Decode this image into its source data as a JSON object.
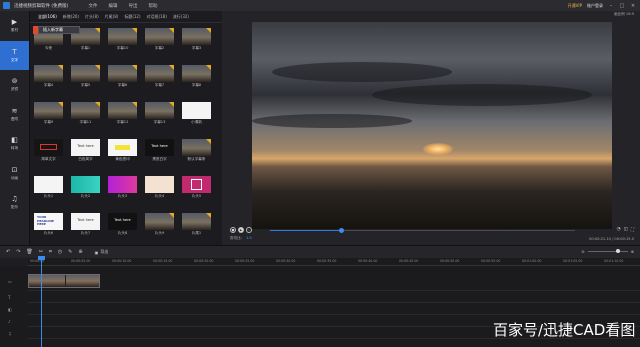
{
  "titlebar": {
    "app_title": "迅捷视频剪辑软件 (免费版)",
    "menu": [
      "文件",
      "编辑",
      "导出",
      "帮助"
    ],
    "vip": "开通VIP",
    "account": "账户登录"
  },
  "rail": [
    {
      "label": "素材",
      "icon": "▶"
    },
    {
      "label": "文字",
      "icon": "T"
    },
    {
      "label": "滤镜",
      "icon": "⊚"
    },
    {
      "label": "叠附",
      "icon": "≋"
    },
    {
      "label": "转场",
      "icon": "◧"
    },
    {
      "label": "动画",
      "icon": "⊡"
    },
    {
      "label": "配乐",
      "icon": "♫"
    }
  ],
  "library": {
    "tabs": [
      "全部(106)",
      "新增(20)",
      "片头(8)",
      "片尾(8)",
      "标题(12)",
      "对话框(18)",
      "流行(32)"
    ],
    "popup": "插入新字幕",
    "items": [
      {
        "label": "今夜",
        "style": "sky"
      },
      {
        "label": "字幕1",
        "style": "sky"
      },
      {
        "label": "字幕10",
        "style": "sky"
      },
      {
        "label": "字幕2",
        "style": "sky"
      },
      {
        "label": "字幕3",
        "style": "sky"
      },
      {
        "label": "字幕4",
        "style": "sky"
      },
      {
        "label": "字幕5",
        "style": "sky"
      },
      {
        "label": "字幕6",
        "style": "sky"
      },
      {
        "label": "字幕7",
        "style": "sky"
      },
      {
        "label": "字幕8",
        "style": "sky"
      },
      {
        "label": "字幕9",
        "style": "sky"
      },
      {
        "label": "字幕11",
        "style": "sky"
      },
      {
        "label": "字幕12",
        "style": "sky"
      },
      {
        "label": "字幕13",
        "style": "sky"
      },
      {
        "label": "小清新",
        "style": "white-cap"
      },
      {
        "label": "简单文字",
        "style": "redbox"
      },
      {
        "label": "白色简字",
        "style": "white",
        "text": "Text here"
      },
      {
        "label": "黄色簡印",
        "style": "yellow"
      },
      {
        "label": "黑底白字",
        "style": "dark",
        "text": "Text here"
      },
      {
        "label": "默认字幕条",
        "style": "sky"
      },
      {
        "label": "片头1",
        "style": "white-small"
      },
      {
        "label": "片头2",
        "style": "grad"
      },
      {
        "label": "片头3",
        "style": "mag"
      },
      {
        "label": "片头4",
        "style": "peach"
      },
      {
        "label": "片头5",
        "style": "pink"
      },
      {
        "label": "片头6",
        "style": "note",
        "text": "YOUR HEADLINE HERE"
      },
      {
        "label": "片头7",
        "style": "white",
        "text": "Text here"
      },
      {
        "label": "片头8",
        "style": "dark",
        "text": "Text here"
      },
      {
        "label": "片头9",
        "style": "sky"
      },
      {
        "label": "片尾1",
        "style": "sky"
      }
    ]
  },
  "preview": {
    "top_text": "画比例 16:9",
    "time_label": "剪切比:",
    "time_value": "1.0",
    "timecode": "00:00:21.10 / 00:00:15.0"
  },
  "timeline": {
    "export_label": "导出",
    "ticks": [
      "00:00:00",
      "00:00:05.00",
      "00:00:10.00",
      "00:00:15.00",
      "00:00:20.00",
      "00:00:25.00",
      "00:00:30.00",
      "00:00:35.00",
      "00:00:40.00",
      "00:00:45.00",
      "00:00:50.00",
      "00:00:55.00",
      "00:01:00.00",
      "00:01:05.00",
      "00:01:10.00"
    ]
  },
  "watermark": "百家号/迅捷CAD看图"
}
